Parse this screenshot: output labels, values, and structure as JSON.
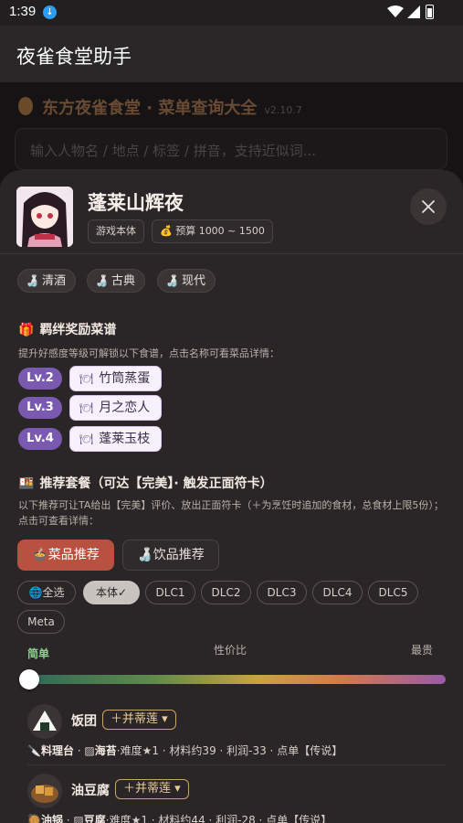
{
  "status_bar": {
    "time": "1:39"
  },
  "app_bar": {
    "title": "夜雀食堂助手"
  },
  "background": {
    "title": "东方夜雀食堂 · 菜单查询大全",
    "version": "v2.10.7",
    "search_placeholder": "输入人物名 / 地点 / 标签 / 拼音，支持近似词..."
  },
  "character": {
    "name": "蓬莱山辉夜",
    "tag_source": "游戏本体",
    "budget_label": "💰 预算 1000 ~ 1500"
  },
  "drink_tags": [
    {
      "label": "清酒"
    },
    {
      "label": "古典"
    },
    {
      "label": "现代"
    }
  ],
  "bond_section": {
    "title": "羁绊奖励菜谱",
    "desc": "提升好感度等级可解锁以下食谱，点击名称可看菜品详情：",
    "rewards": [
      {
        "level": "Lv.2",
        "dish": "竹筒蒸蛋"
      },
      {
        "level": "Lv.3",
        "dish": "月之恋人"
      },
      {
        "level": "Lv.4",
        "dish": "蓬莱玉枝"
      }
    ]
  },
  "recommend_section": {
    "title": "推荐套餐（可达【完美】· 触发正面符卡）",
    "desc": "以下推荐可让TA给出【完美】评价、放出正面符卡（＋为烹饪时追加的食材，总食材上限5份）；点击可查看详情：",
    "tab_dish": "菜品推荐",
    "tab_drink": "饮品推荐",
    "filters": [
      "🌐全选",
      "本体✓",
      "DLC1",
      "DLC2",
      "DLC3",
      "DLC4",
      "DLC5",
      "Meta"
    ],
    "slider": {
      "left": "简单",
      "center": "性价比",
      "right": "最贵",
      "value_fraction": 0
    }
  },
  "dishes": [
    {
      "name": "饭团",
      "add": "＋并蒂莲",
      "tool": "料理台",
      "ingredient": "海苔",
      "meta": "·难度★1 · 材料约39 · 利润-33 · 点单【传说】"
    },
    {
      "name": "油豆腐",
      "add": "＋并蒂莲",
      "tool": "油锅",
      "ingredient": "豆腐",
      "meta": "·难度★1 · 材料约44 · 利润-28 · 点单【传说】"
    }
  ],
  "colors": {
    "accent_btn": "#b8513f",
    "level_badge": "#7a5ab0",
    "sheet_bg": "#2a2526"
  }
}
